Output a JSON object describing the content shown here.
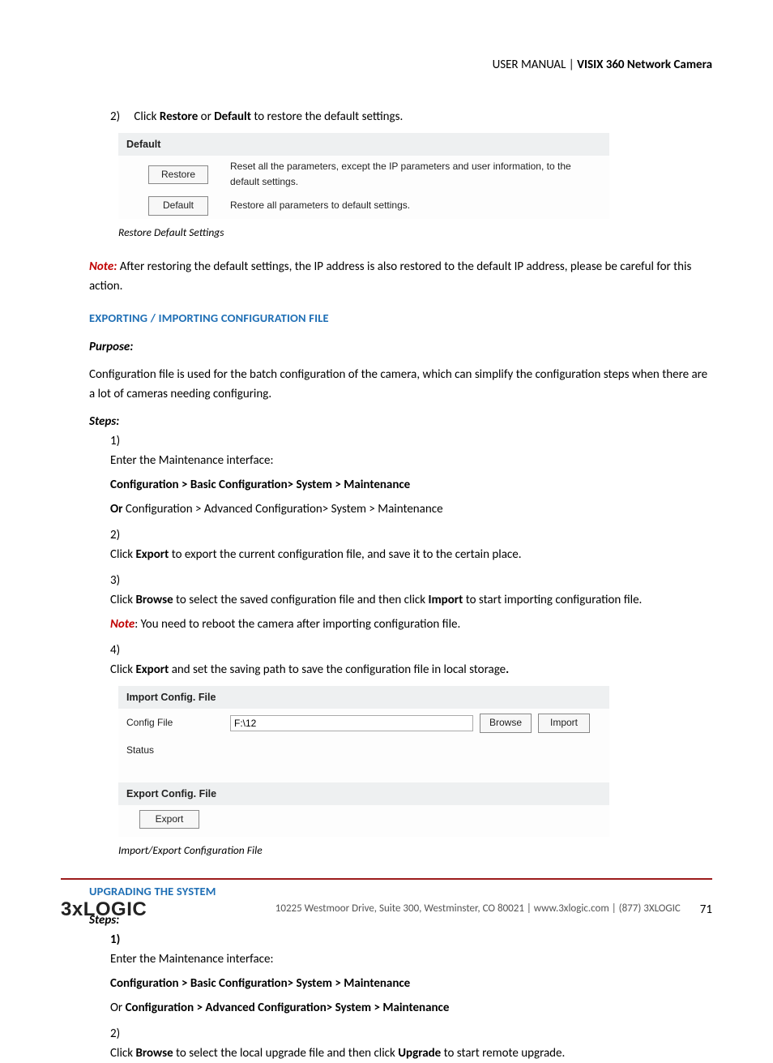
{
  "header": {
    "prefix": "USER MANUAL | ",
    "title": "VISIX 360 Network Camera"
  },
  "intro_step": {
    "num": "2)",
    "pre": "Click ",
    "b1": "Restore",
    "mid": " or ",
    "b2": "Default",
    "post": " to restore the default settings."
  },
  "panel1": {
    "title": "Default",
    "restore_btn": "Restore",
    "restore_desc": "Reset all the parameters, except the IP parameters and user information, to the default settings.",
    "default_btn": "Default",
    "default_desc": "Restore all parameters to default settings."
  },
  "caption1": "Restore Default Settings",
  "note1": {
    "label": "Note:",
    "text": " After restoring the default settings, the IP address is also restored to the default IP address, please be careful for this action."
  },
  "sec1_heading": "EXPORTING / IMPORTING CONFIGURATION FILE",
  "purpose_label": "Purpose:",
  "purpose_text": "Configuration file is used for the batch configuration of the camera, which can simplify the configuration steps when there are a lot of cameras needing configuring.",
  "steps_label": "Steps:",
  "steps1": {
    "s1": {
      "num": "1)",
      "text": "Enter the Maintenance interface:",
      "path1": "Configuration > Basic Configuration> System > Maintenance",
      "or": "Or ",
      "path2": "Configuration > Advanced Configuration> System > Maintenance"
    },
    "s2": {
      "num": "2)",
      "pre": "Click ",
      "b": "Export",
      "post": " to export the current configuration file, and save it to the certain place."
    },
    "s3": {
      "num": "3)",
      "pre": "Click ",
      "b1": "Browse",
      "mid": " to select the saved configuration file and then click ",
      "b2": "Import",
      "post": " to start importing configuration file.",
      "note_label": "Note",
      "note_text": ": You need to reboot the camera after importing configuration file."
    },
    "s4": {
      "num": "4)",
      "pre": "Click ",
      "b": "Export",
      "mid": " and set the saving path to save the configuration file in local storage",
      "dot": "."
    }
  },
  "panel2": {
    "import_title": "Import Config. File",
    "config_label": "Config File",
    "config_value": "F:\\12",
    "browse_btn": "Browse",
    "import_btn": "Import",
    "status_label": "Status",
    "export_title": "Export Config. File",
    "export_btn": "Export"
  },
  "caption2": "Import/Export Configuration File",
  "sec2_heading": "UPGRADING THE SYSTEM",
  "steps2": {
    "s1": {
      "num": "1)",
      "text": "Enter the Maintenance interface:",
      "path1": "Configuration > Basic Configuration> System > Maintenance",
      "or": "Or ",
      "path2": "Configuration > Advanced Configuration> System > Maintenance"
    },
    "s2": {
      "num": "2)",
      "pre": "Click ",
      "b1": "Browse",
      "mid": " to select the local upgrade file and then click ",
      "b2": "Upgrade",
      "post": " to start remote upgrade."
    }
  },
  "footer": {
    "logo": "3xLOGIC",
    "text": "10225 Westmoor Drive, Suite 300, Westminster, CO 80021 | www.3xlogic.com | (877) 3XLOGIC",
    "page": "71"
  }
}
